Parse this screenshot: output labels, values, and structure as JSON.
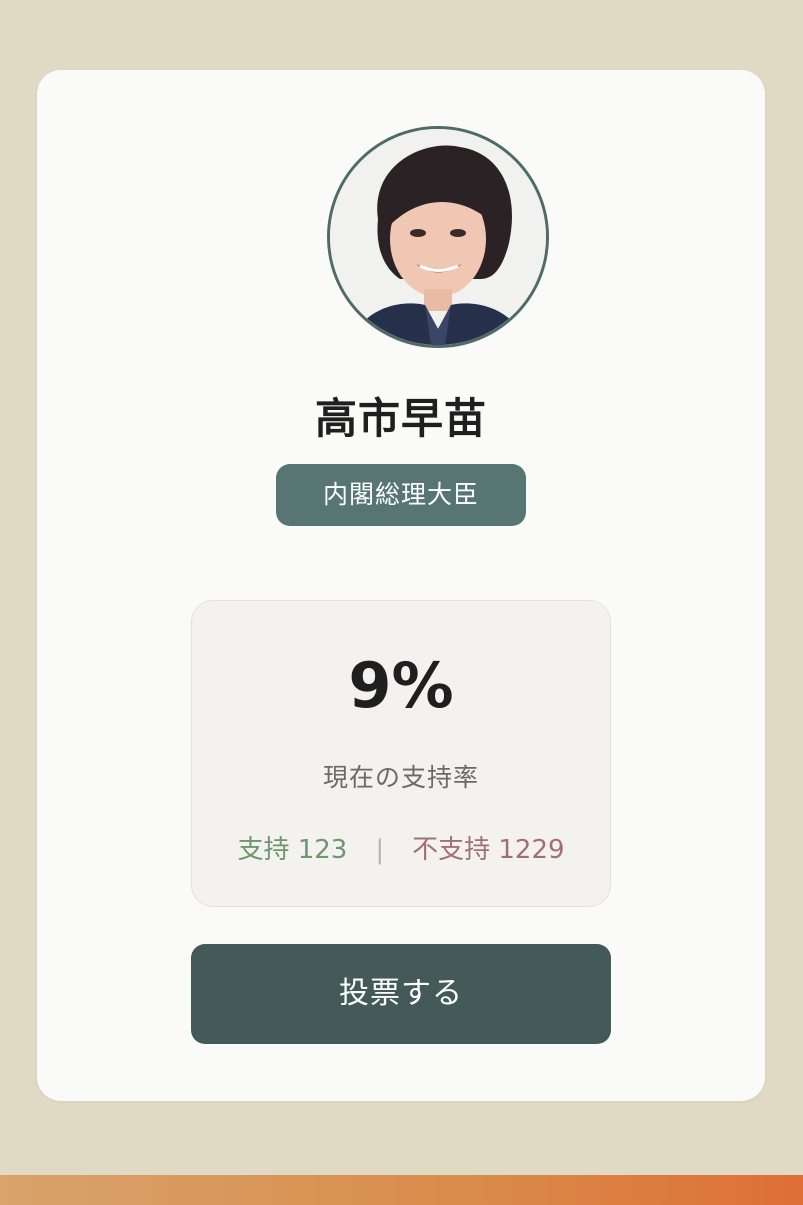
{
  "profile": {
    "name": "高市早苗",
    "role": "内閣総理大臣"
  },
  "stats": {
    "percent": "9%",
    "label": "現在の支持率",
    "support_label": "支持 123",
    "divider": "|",
    "oppose_label": "不支持 1229"
  },
  "actions": {
    "vote_label": "投票する"
  },
  "colors": {
    "background": "#e0d9c4",
    "accent": "#567573",
    "button": "#435a59",
    "support": "#6f966f",
    "oppose": "#a07171"
  }
}
